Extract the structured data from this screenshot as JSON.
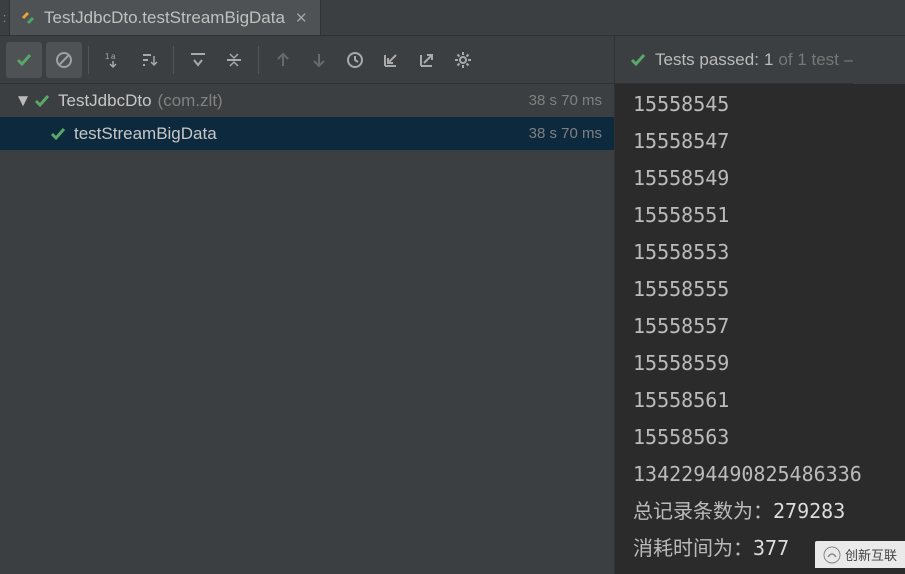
{
  "tab": {
    "prefix_label": ":",
    "title": "TestJdbcDto.testStreamBigData"
  },
  "status": {
    "prefix": "Tests passed:",
    "passed": "1",
    "middle": "of 1 test",
    "suffix": "–"
  },
  "tree": {
    "root": {
      "name": "TestJdbcDto",
      "package": "(com.zlt)",
      "time": "38 s 70 ms"
    },
    "child": {
      "name": "testStreamBigData",
      "time": "38 s 70 ms"
    }
  },
  "output_lines": [
    "15558545",
    "15558547",
    "15558549",
    "15558551",
    "15558553",
    "15558555",
    "15558557",
    "15558559",
    "15558561",
    "15558563",
    "1342294490825486336"
  ],
  "summary": {
    "records_label": "总记录条数为：",
    "records_value": "279283",
    "time_label": "消耗时间为：",
    "time_value": "377"
  },
  "watermark": "创新互联"
}
